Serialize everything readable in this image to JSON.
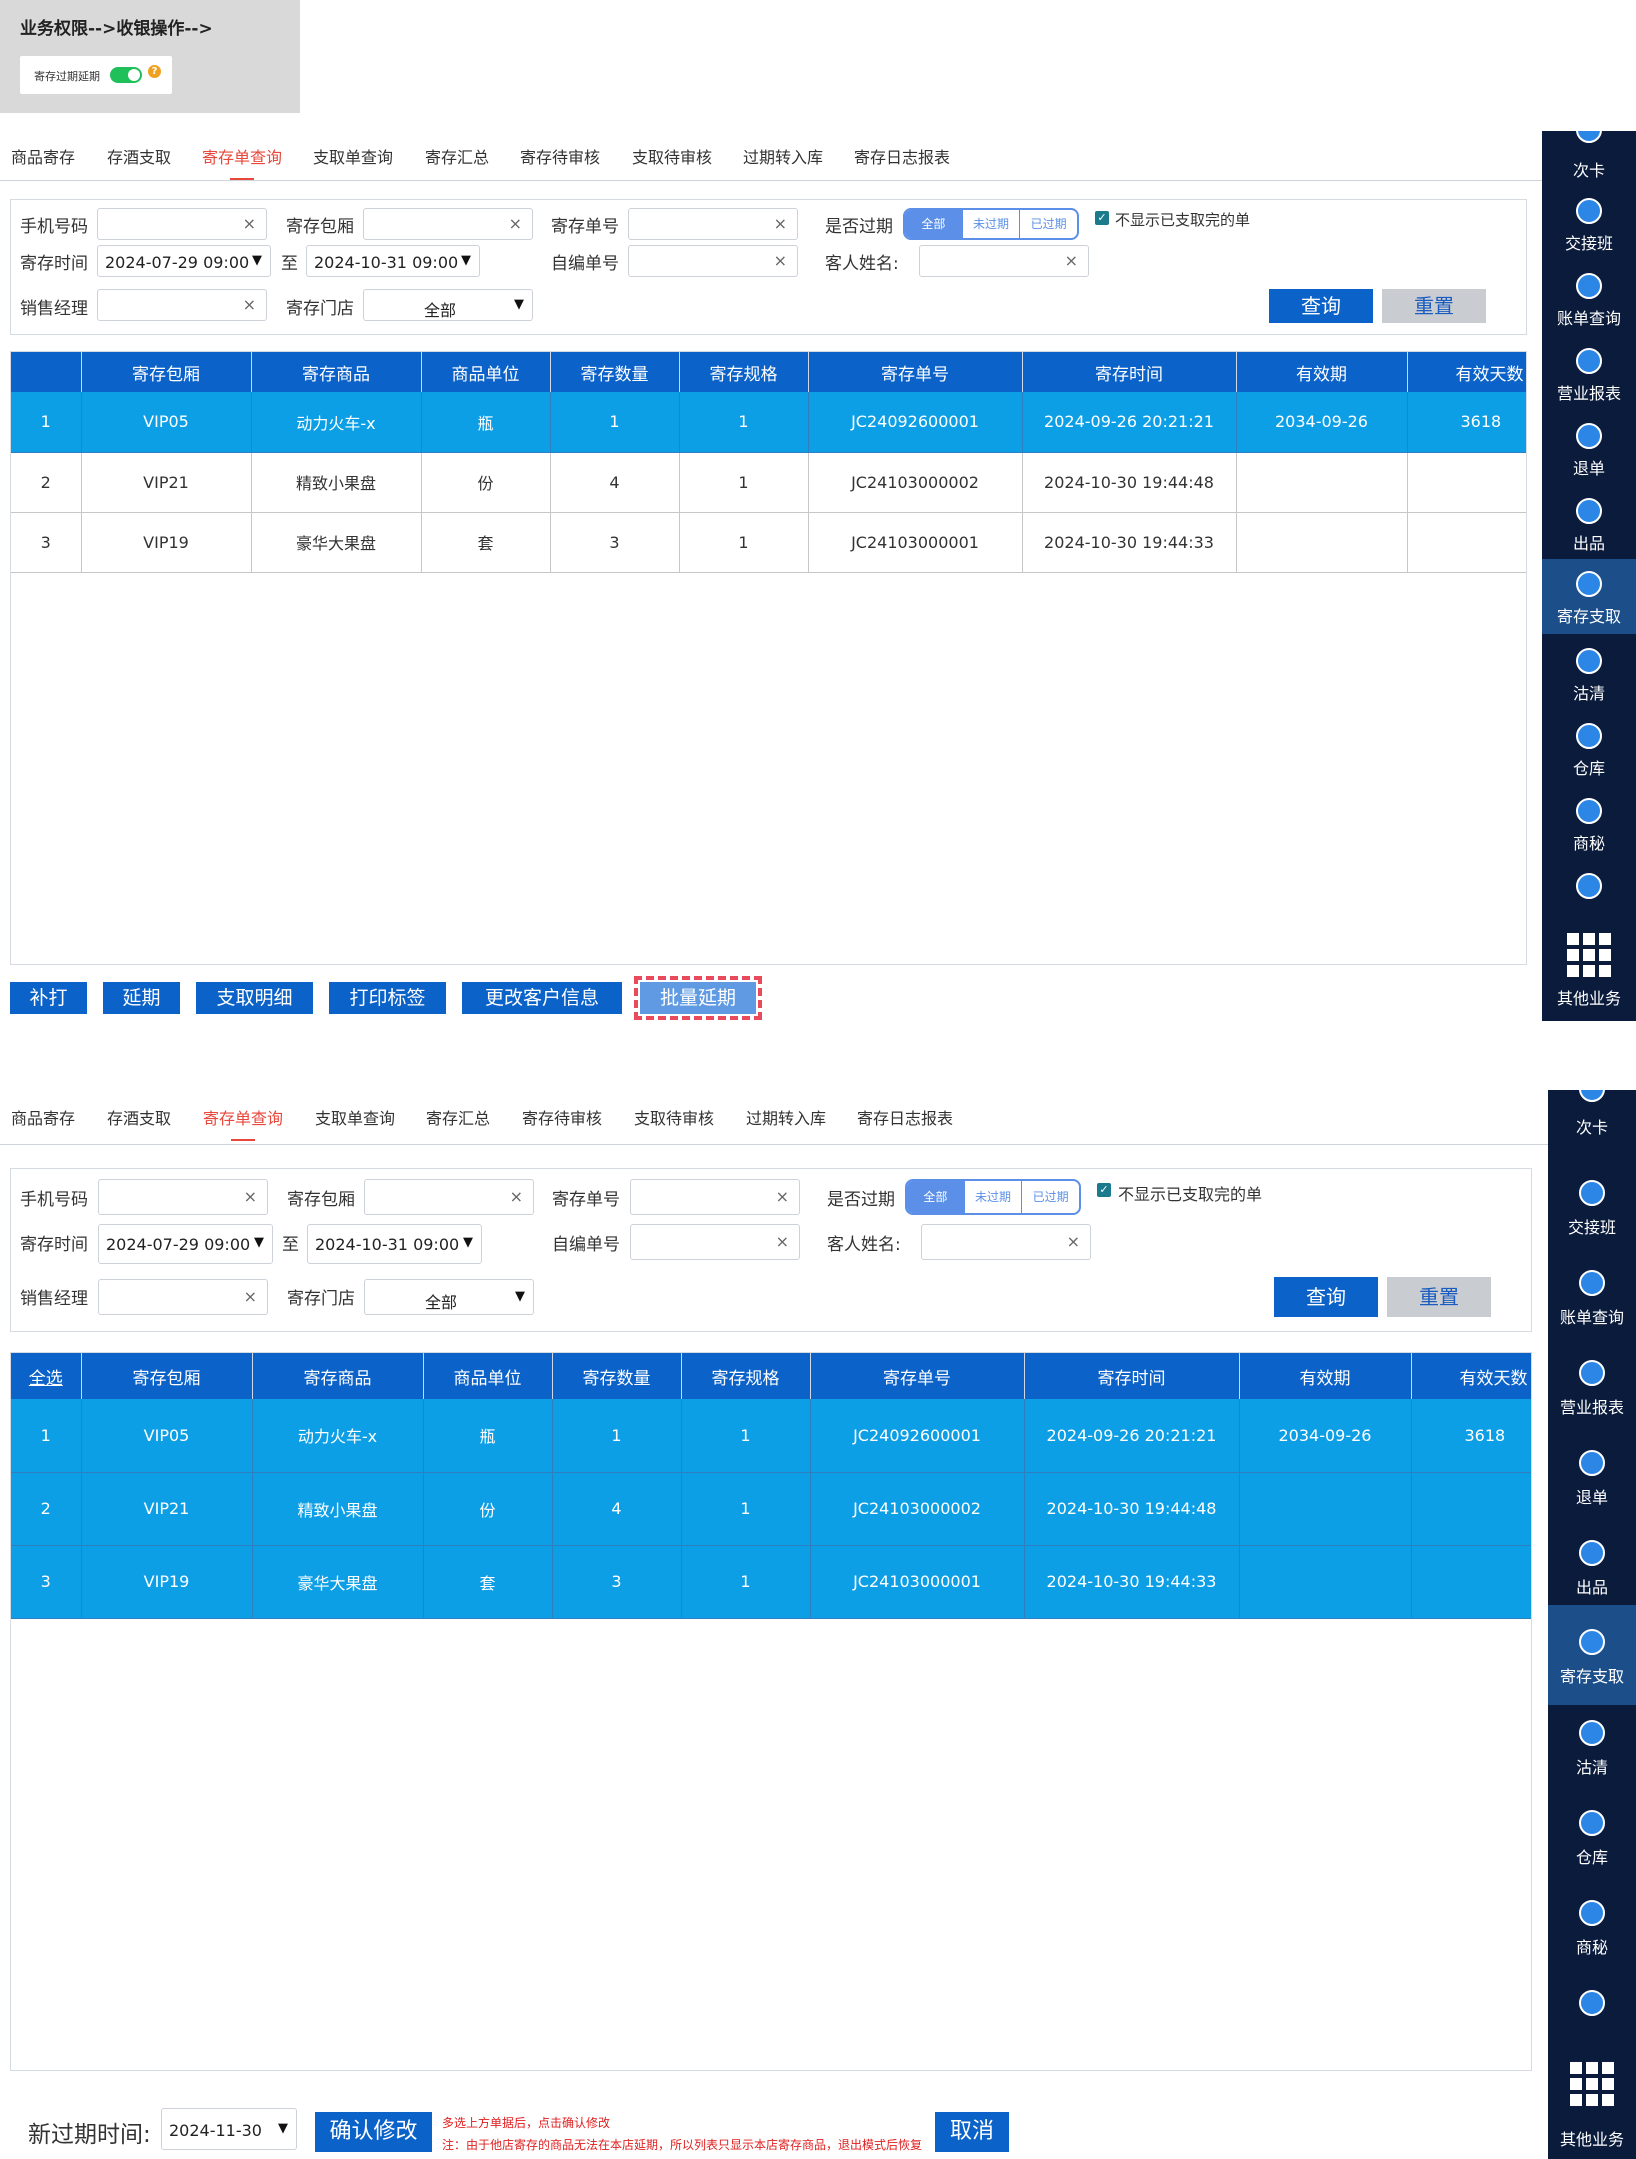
{
  "header": {
    "title": "业务权限-->收银操作-->",
    "toggle_label": "寄存过期延期",
    "help": "?"
  },
  "tabs": [
    "商品寄存",
    "存酒支取",
    "寄存单查询",
    "支取单查询",
    "寄存汇总",
    "寄存待审核",
    "支取待审核",
    "过期转入库",
    "寄存日志报表"
  ],
  "filters": {
    "phone_label": "手机号码",
    "room_label": "寄存包厢",
    "order_label": "寄存单号",
    "expired_label": "是否过期",
    "expired_options": [
      "全部",
      "未过期",
      "已过期"
    ],
    "hide_done_label": "不显示已支取完的单",
    "time_label": "寄存时间",
    "time_from": "2024-07-29 09:00",
    "time_to_label": "至",
    "time_to": "2024-10-31 09:00",
    "self_no_label": "自编单号",
    "customer_label": "客人姓名:",
    "manager_label": "销售经理",
    "store_label": "寄存门店",
    "store_value": "全部",
    "query_label": "查询",
    "reset_label": "重置",
    "clear": "×",
    "arrow": "▼",
    "check": "✓"
  },
  "table": {
    "headers": [
      "寄存包厢",
      "寄存商品",
      "商品单位",
      "寄存数量",
      "寄存规格",
      "寄存单号",
      "寄存时间",
      "有效期",
      "有效天数"
    ],
    "select_all": "全选",
    "rows": [
      {
        "idx": "1",
        "room": "VIP05",
        "item": "动力火车-x",
        "unit": "瓶",
        "qty": "1",
        "spec": "1",
        "order": "JC24092600001",
        "time": "2024-09-26 20:21:21",
        "expiry": "2034-09-26",
        "days": "3618"
      },
      {
        "idx": "2",
        "room": "VIP21",
        "item": "精致小果盘",
        "unit": "份",
        "qty": "4",
        "spec": "1",
        "order": "JC24103000002",
        "time": "2024-10-30 19:44:48",
        "expiry": "",
        "days": ""
      },
      {
        "idx": "3",
        "room": "VIP19",
        "item": "豪华大果盘",
        "unit": "套",
        "qty": "3",
        "spec": "1",
        "order": "JC24103000001",
        "time": "2024-10-30 19:44:33",
        "expiry": "",
        "days": ""
      }
    ]
  },
  "actions": [
    "补打",
    "延期",
    "支取明细",
    "打印标签",
    "更改客户信息",
    "批量延期"
  ],
  "sidebar": {
    "items": [
      "次卡",
      "交接班",
      "账单查询",
      "营业报表",
      "退单",
      "出品",
      "寄存支取",
      "沽清",
      "仓库",
      "商秘",
      "",
      "其他业务"
    ],
    "active": "寄存支取"
  },
  "batch": {
    "new_expiry_label": "新过期时间:",
    "new_expiry_value": "2024-11-30",
    "confirm_label": "确认修改",
    "note1": "多选上方单据后，点击确认修改",
    "note2": "注：由于他店寄存的商品无法在本店延期，所以列表只显示本店寄存商品，退出模式后恢复",
    "cancel_label": "取消"
  }
}
